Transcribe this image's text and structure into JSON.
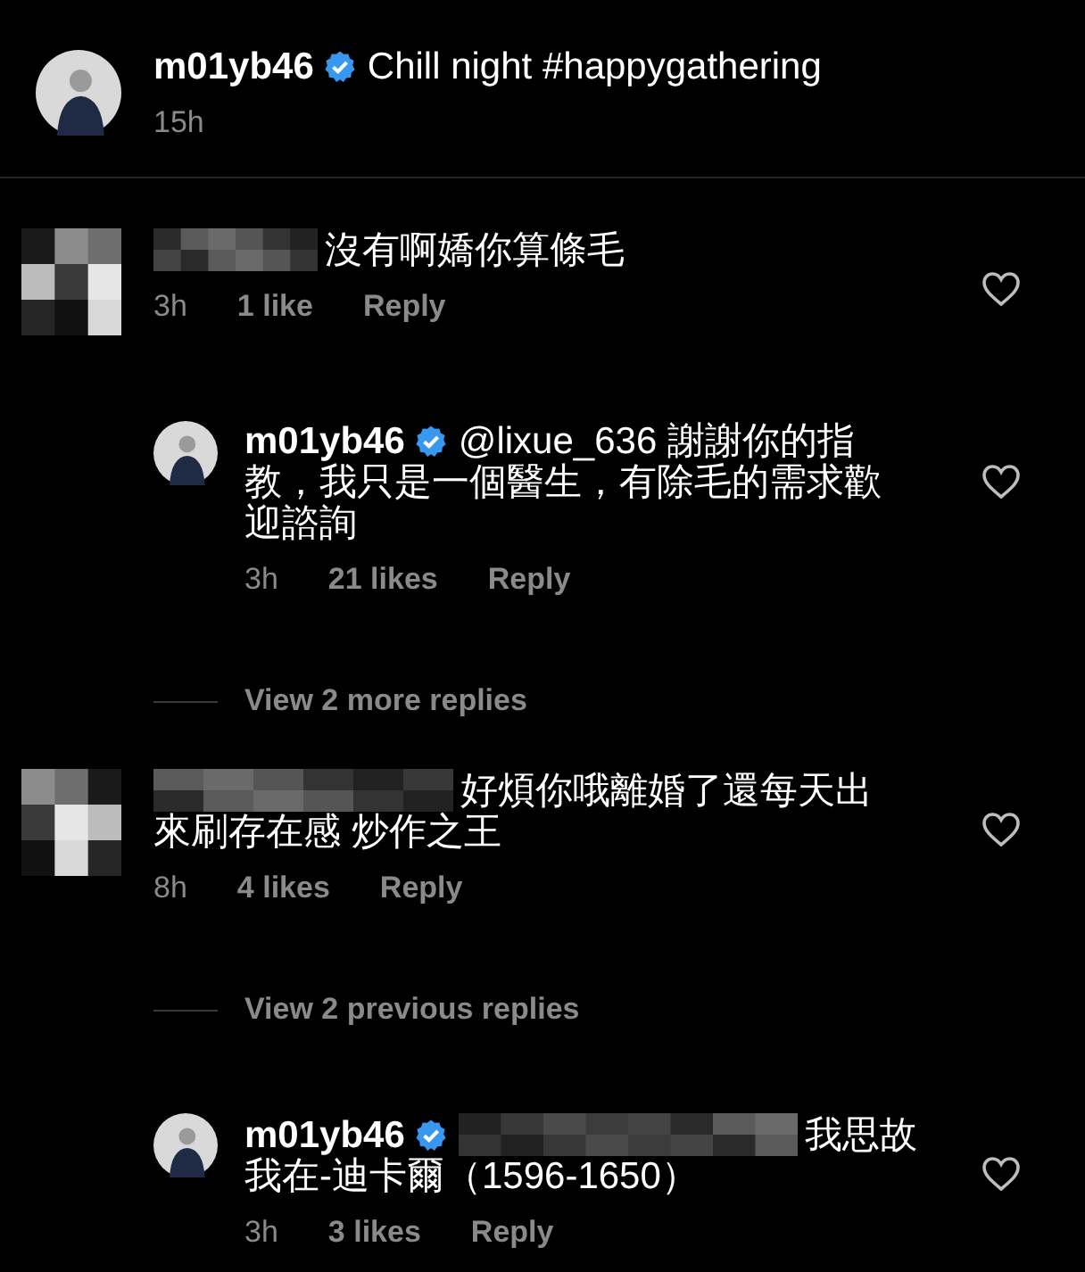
{
  "caption": {
    "avatar_pixelated": false,
    "author": {
      "name": "m01yb46",
      "verified": true
    },
    "lines": [
      "Chill night #happygathering"
    ],
    "time": "15h"
  },
  "items": [
    {
      "kind": "comment",
      "avatar_pixelated": true,
      "author": {
        "redacted": true
      },
      "lines": [
        "沒有啊嬌你算條毛"
      ],
      "time": "3h",
      "likes": "1 like",
      "reply": "Reply"
    },
    {
      "kind": "reply",
      "avatar_pixelated": false,
      "author": {
        "name": "m01yb46",
        "verified": true
      },
      "lines": [
        "@lixue_636 謝謝你的指",
        "教，我只是一個醫生，有除毛的需求歡",
        "迎諮詢"
      ],
      "time": "3h",
      "likes": "21 likes",
      "reply": "Reply"
    },
    {
      "kind": "view_replies",
      "label": "View 2 more replies"
    },
    {
      "kind": "comment",
      "avatar_pixelated": true,
      "author": {
        "redacted": true
      },
      "lines": [
        "好煩你哦離婚了還每天出",
        "來刷存在感 炒作之王"
      ],
      "time": "8h",
      "likes": "4 likes",
      "reply": "Reply"
    },
    {
      "kind": "view_replies",
      "label": "View 2 previous replies"
    },
    {
      "kind": "reply",
      "avatar_pixelated": false,
      "author": {
        "name": "m01yb46",
        "verified": true
      },
      "mention_redacted": true,
      "lines": [
        "我思故",
        "我在-迪卡爾（1596-1650）"
      ],
      "time": "3h",
      "likes": "3 likes",
      "reply": "Reply"
    }
  ]
}
